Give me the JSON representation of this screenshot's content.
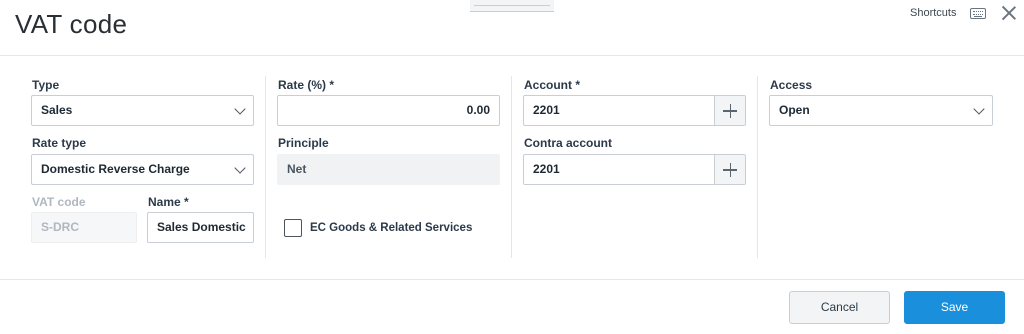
{
  "header": {
    "title": "VAT code",
    "shortcuts_label": "Shortcuts",
    "keyboard_icon": "keyboard-icon",
    "close_icon": "close-icon"
  },
  "form": {
    "type": {
      "label": "Type",
      "value": "Sales"
    },
    "rate_type": {
      "label": "Rate type",
      "value": "Domestic Reverse Charge"
    },
    "vat_code": {
      "label": "VAT code",
      "value": "S-DRC"
    },
    "name": {
      "label": "Name *",
      "value": "Sales Domestic"
    },
    "rate": {
      "label": "Rate (%) *",
      "value": "0.00"
    },
    "principle": {
      "label": "Principle",
      "value": "Net"
    },
    "ec_goods": {
      "label": "EC Goods & Related Services",
      "checked": false
    },
    "account": {
      "label": "Account *",
      "value": "2201"
    },
    "contra_account": {
      "label": "Contra account",
      "value": "2201"
    },
    "access": {
      "label": "Access",
      "value": "Open"
    }
  },
  "footer": {
    "cancel_label": "Cancel",
    "save_label": "Save"
  },
  "colors": {
    "primary": "#1a8fdc",
    "text": "#2b3a4a",
    "border": "#c9ced4"
  }
}
